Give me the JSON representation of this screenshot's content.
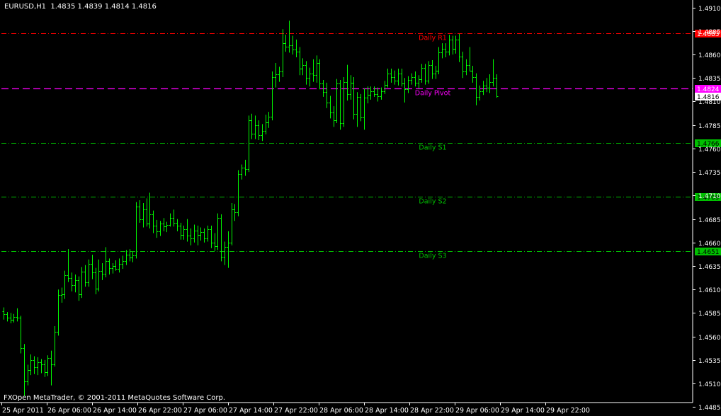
{
  "header": {
    "symbol": "EURUSD,H1",
    "ohlc": "1.4835 1.4839 1.4814 1.4816"
  },
  "footer": {
    "copyright": "FXOpen MetaTrader, © 2001-2011 MetaQuotes Software Corp."
  },
  "colors": {
    "background": "#000000",
    "bars": "#00ff00",
    "axis": "#ffffff",
    "r1": "#ff0000",
    "pivot": "#ff00ff",
    "support": "#00c000"
  },
  "chart_data": {
    "type": "ohlc",
    "grid": false,
    "ylim": [
      1.4495,
      1.4915
    ],
    "yticks": [
      "1.4910",
      "1.4885",
      "1.4860",
      "1.4835",
      "1.4810",
      "1.4785",
      "1.4760",
      "1.4735",
      "1.4710",
      "1.4685",
      "1.4660",
      "1.4635",
      "1.4610",
      "1.4585",
      "1.4560",
      "1.4535",
      "1.4510",
      "1.4485"
    ],
    "xtick_labels": [
      "25 Apr 2011",
      "26 Apr 06:00",
      "26 Apr 14:00",
      "26 Apr 22:00",
      "27 Apr 06:00",
      "27 Apr 14:00",
      "27 Apr 22:00",
      "28 Apr 06:00",
      "28 Apr 14:00",
      "28 Apr 22:00",
      "29 Apr 06:00",
      "29 Apr 14:00",
      "29 Apr 22:00"
    ],
    "levels": [
      {
        "name": "Daily R1",
        "value": 1.4883,
        "tag": "1.4883",
        "color": "#ff0000"
      },
      {
        "name": "Daily Pivot",
        "value": 1.4824,
        "tag": "1.4824",
        "color": "#ff00ff"
      },
      {
        "name": "Daily S1",
        "value": 1.4766,
        "tag": "1.4766",
        "color": "#00c000"
      },
      {
        "name": "Daily S2",
        "value": 1.4709,
        "tag": "1.4709",
        "color": "#00c000"
      },
      {
        "name": "Daily S3",
        "value": 1.4651,
        "tag": "1.4651",
        "color": "#00c000"
      }
    ],
    "current_price": {
      "value": 1.4816,
      "tag": "1.4816"
    },
    "bars": [
      {
        "o": 1.4587,
        "h": 1.4591,
        "l": 1.4578,
        "c": 1.4584
      },
      {
        "o": 1.4584,
        "h": 1.4586,
        "l": 1.4576,
        "c": 1.458
      },
      {
        "o": 1.458,
        "h": 1.4585,
        "l": 1.4574,
        "c": 1.4578
      },
      {
        "o": 1.4578,
        "h": 1.4584,
        "l": 1.4575,
        "c": 1.4581
      },
      {
        "o": 1.4581,
        "h": 1.459,
        "l": 1.4576,
        "c": 1.458
      },
      {
        "o": 1.458,
        "h": 1.4582,
        "l": 1.4542,
        "c": 1.4548
      },
      {
        "o": 1.4548,
        "h": 1.4552,
        "l": 1.4497,
        "c": 1.4512
      },
      {
        "o": 1.4512,
        "h": 1.453,
        "l": 1.4508,
        "c": 1.4524
      },
      {
        "o": 1.4524,
        "h": 1.4541,
        "l": 1.4519,
        "c": 1.4535
      },
      {
        "o": 1.4535,
        "h": 1.4539,
        "l": 1.452,
        "c": 1.4527
      },
      {
        "o": 1.4527,
        "h": 1.4538,
        "l": 1.4519,
        "c": 1.4533
      },
      {
        "o": 1.4533,
        "h": 1.4536,
        "l": 1.4521,
        "c": 1.453
      },
      {
        "o": 1.453,
        "h": 1.4535,
        "l": 1.4517,
        "c": 1.4522
      },
      {
        "o": 1.4522,
        "h": 1.454,
        "l": 1.4518,
        "c": 1.4537
      },
      {
        "o": 1.4537,
        "h": 1.4545,
        "l": 1.4508,
        "c": 1.453
      },
      {
        "o": 1.453,
        "h": 1.4571,
        "l": 1.4528,
        "c": 1.4565
      },
      {
        "o": 1.4565,
        "h": 1.461,
        "l": 1.4561,
        "c": 1.4604
      },
      {
        "o": 1.4604,
        "h": 1.4612,
        "l": 1.4596,
        "c": 1.4605
      },
      {
        "o": 1.4605,
        "h": 1.463,
        "l": 1.46,
        "c": 1.4625
      },
      {
        "o": 1.4625,
        "h": 1.4653,
        "l": 1.4618,
        "c": 1.4622
      },
      {
        "o": 1.4622,
        "h": 1.4628,
        "l": 1.4608,
        "c": 1.4615
      },
      {
        "o": 1.4615,
        "h": 1.4626,
        "l": 1.4607,
        "c": 1.462
      },
      {
        "o": 1.462,
        "h": 1.4624,
        "l": 1.4598,
        "c": 1.4605
      },
      {
        "o": 1.4605,
        "h": 1.4634,
        "l": 1.4601,
        "c": 1.4629
      },
      {
        "o": 1.4629,
        "h": 1.4636,
        "l": 1.4613,
        "c": 1.4618
      },
      {
        "o": 1.4618,
        "h": 1.4642,
        "l": 1.4613,
        "c": 1.4637
      },
      {
        "o": 1.4637,
        "h": 1.4647,
        "l": 1.4621,
        "c": 1.4628
      },
      {
        "o": 1.4628,
        "h": 1.4633,
        "l": 1.4605,
        "c": 1.4611
      },
      {
        "o": 1.4611,
        "h": 1.4642,
        "l": 1.4608,
        "c": 1.463
      },
      {
        "o": 1.463,
        "h": 1.4638,
        "l": 1.462,
        "c": 1.4627
      },
      {
        "o": 1.4627,
        "h": 1.4655,
        "l": 1.4623,
        "c": 1.464
      },
      {
        "o": 1.464,
        "h": 1.4643,
        "l": 1.4626,
        "c": 1.4633
      },
      {
        "o": 1.4633,
        "h": 1.4638,
        "l": 1.4627,
        "c": 1.4635
      },
      {
        "o": 1.4635,
        "h": 1.4641,
        "l": 1.463,
        "c": 1.4632
      },
      {
        "o": 1.4632,
        "h": 1.4643,
        "l": 1.4628,
        "c": 1.4637
      },
      {
        "o": 1.4637,
        "h": 1.4646,
        "l": 1.4632,
        "c": 1.464
      },
      {
        "o": 1.464,
        "h": 1.4652,
        "l": 1.4636,
        "c": 1.4647
      },
      {
        "o": 1.4647,
        "h": 1.4653,
        "l": 1.464,
        "c": 1.4644
      },
      {
        "o": 1.4644,
        "h": 1.465,
        "l": 1.4639,
        "c": 1.4646
      },
      {
        "o": 1.4646,
        "h": 1.4703,
        "l": 1.4643,
        "c": 1.4698
      },
      {
        "o": 1.4698,
        "h": 1.4705,
        "l": 1.4681,
        "c": 1.4685
      },
      {
        "o": 1.4685,
        "h": 1.4702,
        "l": 1.4676,
        "c": 1.4695
      },
      {
        "o": 1.4695,
        "h": 1.4707,
        "l": 1.4677,
        "c": 1.468
      },
      {
        "o": 1.468,
        "h": 1.4713,
        "l": 1.4675,
        "c": 1.469
      },
      {
        "o": 1.469,
        "h": 1.4694,
        "l": 1.467,
        "c": 1.4678
      },
      {
        "o": 1.4678,
        "h": 1.4684,
        "l": 1.4665,
        "c": 1.4672
      },
      {
        "o": 1.4672,
        "h": 1.4683,
        "l": 1.4667,
        "c": 1.468
      },
      {
        "o": 1.468,
        "h": 1.4686,
        "l": 1.4672,
        "c": 1.4677
      },
      {
        "o": 1.4677,
        "h": 1.4682,
        "l": 1.4671,
        "c": 1.4679
      },
      {
        "o": 1.4679,
        "h": 1.4691,
        "l": 1.4677,
        "c": 1.4686
      },
      {
        "o": 1.4686,
        "h": 1.4695,
        "l": 1.4677,
        "c": 1.4681
      },
      {
        "o": 1.4681,
        "h": 1.4685,
        "l": 1.4672,
        "c": 1.4678
      },
      {
        "o": 1.4678,
        "h": 1.4681,
        "l": 1.4663,
        "c": 1.4668
      },
      {
        "o": 1.4668,
        "h": 1.4678,
        "l": 1.4663,
        "c": 1.4674
      },
      {
        "o": 1.4674,
        "h": 1.4685,
        "l": 1.4661,
        "c": 1.4667
      },
      {
        "o": 1.4667,
        "h": 1.4675,
        "l": 1.4657,
        "c": 1.4664
      },
      {
        "o": 1.4664,
        "h": 1.4679,
        "l": 1.466,
        "c": 1.4673
      },
      {
        "o": 1.4673,
        "h": 1.4678,
        "l": 1.4657,
        "c": 1.4668
      },
      {
        "o": 1.4668,
        "h": 1.4676,
        "l": 1.4662,
        "c": 1.4671
      },
      {
        "o": 1.4671,
        "h": 1.4675,
        "l": 1.466,
        "c": 1.4664
      },
      {
        "o": 1.4664,
        "h": 1.4678,
        "l": 1.4661,
        "c": 1.4674
      },
      {
        "o": 1.4674,
        "h": 1.4678,
        "l": 1.4654,
        "c": 1.466
      },
      {
        "o": 1.466,
        "h": 1.467,
        "l": 1.4651,
        "c": 1.4656
      },
      {
        "o": 1.4656,
        "h": 1.4691,
        "l": 1.4652,
        "c": 1.4686
      },
      {
        "o": 1.4686,
        "h": 1.469,
        "l": 1.464,
        "c": 1.4645
      },
      {
        "o": 1.4645,
        "h": 1.4661,
        "l": 1.4636,
        "c": 1.4655
      },
      {
        "o": 1.4655,
        "h": 1.4672,
        "l": 1.4633,
        "c": 1.466
      },
      {
        "o": 1.466,
        "h": 1.4702,
        "l": 1.4657,
        "c": 1.4695
      },
      {
        "o": 1.4695,
        "h": 1.4701,
        "l": 1.4683,
        "c": 1.4692
      },
      {
        "o": 1.4692,
        "h": 1.4737,
        "l": 1.4688,
        "c": 1.4733
      },
      {
        "o": 1.4733,
        "h": 1.4743,
        "l": 1.4727,
        "c": 1.474
      },
      {
        "o": 1.474,
        "h": 1.4748,
        "l": 1.4731,
        "c": 1.4738
      },
      {
        "o": 1.4738,
        "h": 1.4795,
        "l": 1.4735,
        "c": 1.479
      },
      {
        "o": 1.479,
        "h": 1.4797,
        "l": 1.477,
        "c": 1.4776
      },
      {
        "o": 1.4776,
        "h": 1.4795,
        "l": 1.477,
        "c": 1.4785
      },
      {
        "o": 1.4785,
        "h": 1.479,
        "l": 1.4769,
        "c": 1.4774
      },
      {
        "o": 1.4774,
        "h": 1.4786,
        "l": 1.4768,
        "c": 1.4779
      },
      {
        "o": 1.4779,
        "h": 1.4796,
        "l": 1.4775,
        "c": 1.4788
      },
      {
        "o": 1.4788,
        "h": 1.4799,
        "l": 1.4782,
        "c": 1.4794
      },
      {
        "o": 1.4794,
        "h": 1.4842,
        "l": 1.479,
        "c": 1.4836
      },
      {
        "o": 1.4836,
        "h": 1.4851,
        "l": 1.4825,
        "c": 1.4839
      },
      {
        "o": 1.4839,
        "h": 1.4847,
        "l": 1.4831,
        "c": 1.4842
      },
      {
        "o": 1.4842,
        "h": 1.4887,
        "l": 1.4836,
        "c": 1.4872
      },
      {
        "o": 1.4872,
        "h": 1.4881,
        "l": 1.4863,
        "c": 1.4868
      },
      {
        "o": 1.4868,
        "h": 1.4896,
        "l": 1.4862,
        "c": 1.487
      },
      {
        "o": 1.487,
        "h": 1.488,
        "l": 1.486,
        "c": 1.4865
      },
      {
        "o": 1.4865,
        "h": 1.4876,
        "l": 1.4857,
        "c": 1.4863
      },
      {
        "o": 1.4863,
        "h": 1.4868,
        "l": 1.4838,
        "c": 1.4845
      },
      {
        "o": 1.4845,
        "h": 1.4856,
        "l": 1.4838,
        "c": 1.4849
      },
      {
        "o": 1.4849,
        "h": 1.4853,
        "l": 1.4828,
        "c": 1.4835
      },
      {
        "o": 1.4835,
        "h": 1.4846,
        "l": 1.4826,
        "c": 1.484
      },
      {
        "o": 1.484,
        "h": 1.4855,
        "l": 1.4831,
        "c": 1.4838
      },
      {
        "o": 1.4838,
        "h": 1.4859,
        "l": 1.483,
        "c": 1.4851
      },
      {
        "o": 1.4851,
        "h": 1.4855,
        "l": 1.4823,
        "c": 1.4829
      },
      {
        "o": 1.4829,
        "h": 1.4833,
        "l": 1.4815,
        "c": 1.482
      },
      {
        "o": 1.482,
        "h": 1.483,
        "l": 1.4803,
        "c": 1.4809
      },
      {
        "o": 1.4809,
        "h": 1.4816,
        "l": 1.4792,
        "c": 1.4798
      },
      {
        "o": 1.4798,
        "h": 1.4805,
        "l": 1.4783,
        "c": 1.479
      },
      {
        "o": 1.479,
        "h": 1.4834,
        "l": 1.4787,
        "c": 1.4829
      },
      {
        "o": 1.4829,
        "h": 1.4833,
        "l": 1.478,
        "c": 1.4787
      },
      {
        "o": 1.4787,
        "h": 1.4836,
        "l": 1.4783,
        "c": 1.4831
      },
      {
        "o": 1.4831,
        "h": 1.4849,
        "l": 1.4811,
        "c": 1.4818
      },
      {
        "o": 1.4818,
        "h": 1.4838,
        "l": 1.4812,
        "c": 1.483
      },
      {
        "o": 1.483,
        "h": 1.4836,
        "l": 1.4791,
        "c": 1.4797
      },
      {
        "o": 1.4797,
        "h": 1.482,
        "l": 1.4783,
        "c": 1.4815
      },
      {
        "o": 1.4815,
        "h": 1.4818,
        "l": 1.4789,
        "c": 1.4793
      },
      {
        "o": 1.4793,
        "h": 1.4824,
        "l": 1.478,
        "c": 1.4814
      },
      {
        "o": 1.4814,
        "h": 1.4826,
        "l": 1.4808,
        "c": 1.4817
      },
      {
        "o": 1.4817,
        "h": 1.4826,
        "l": 1.4812,
        "c": 1.4821
      },
      {
        "o": 1.4821,
        "h": 1.4826,
        "l": 1.4815,
        "c": 1.4818
      },
      {
        "o": 1.4818,
        "h": 1.4825,
        "l": 1.481,
        "c": 1.4816
      },
      {
        "o": 1.4816,
        "h": 1.4825,
        "l": 1.4812,
        "c": 1.4821
      },
      {
        "o": 1.4821,
        "h": 1.4832,
        "l": 1.4818,
        "c": 1.4828
      },
      {
        "o": 1.4828,
        "h": 1.4845,
        "l": 1.4825,
        "c": 1.484
      },
      {
        "o": 1.484,
        "h": 1.4845,
        "l": 1.483,
        "c": 1.4836
      },
      {
        "o": 1.4836,
        "h": 1.4843,
        "l": 1.4828,
        "c": 1.4832
      },
      {
        "o": 1.4832,
        "h": 1.4845,
        "l": 1.4827,
        "c": 1.484
      },
      {
        "o": 1.484,
        "h": 1.4845,
        "l": 1.4826,
        "c": 1.4829
      },
      {
        "o": 1.4829,
        "h": 1.4835,
        "l": 1.4809,
        "c": 1.4823
      },
      {
        "o": 1.4823,
        "h": 1.4837,
        "l": 1.4819,
        "c": 1.4833
      },
      {
        "o": 1.4833,
        "h": 1.484,
        "l": 1.4828,
        "c": 1.4836
      },
      {
        "o": 1.4836,
        "h": 1.4842,
        "l": 1.4826,
        "c": 1.483
      },
      {
        "o": 1.483,
        "h": 1.4838,
        "l": 1.4824,
        "c": 1.4834
      },
      {
        "o": 1.4834,
        "h": 1.485,
        "l": 1.483,
        "c": 1.4846
      },
      {
        "o": 1.4846,
        "h": 1.485,
        "l": 1.4828,
        "c": 1.4832
      },
      {
        "o": 1.4832,
        "h": 1.4853,
        "l": 1.4829,
        "c": 1.4849
      },
      {
        "o": 1.4849,
        "h": 1.4854,
        "l": 1.4834,
        "c": 1.484
      },
      {
        "o": 1.484,
        "h": 1.4848,
        "l": 1.4834,
        "c": 1.4843
      },
      {
        "o": 1.4843,
        "h": 1.4868,
        "l": 1.4839,
        "c": 1.4862
      },
      {
        "o": 1.4862,
        "h": 1.4872,
        "l": 1.4856,
        "c": 1.4866
      },
      {
        "o": 1.4866,
        "h": 1.4872,
        "l": 1.4857,
        "c": 1.4863
      },
      {
        "o": 1.4863,
        "h": 1.4881,
        "l": 1.4859,
        "c": 1.4876
      },
      {
        "o": 1.4876,
        "h": 1.488,
        "l": 1.486,
        "c": 1.4866
      },
      {
        "o": 1.4866,
        "h": 1.488,
        "l": 1.4861,
        "c": 1.4876
      },
      {
        "o": 1.4876,
        "h": 1.4882,
        "l": 1.4852,
        "c": 1.4858
      },
      {
        "o": 1.4858,
        "h": 1.4863,
        "l": 1.4835,
        "c": 1.4842
      },
      {
        "o": 1.4842,
        "h": 1.4855,
        "l": 1.4838,
        "c": 1.4849
      },
      {
        "o": 1.4849,
        "h": 1.4868,
        "l": 1.4842,
        "c": 1.4843
      },
      {
        "o": 1.4843,
        "h": 1.4848,
        "l": 1.483,
        "c": 1.4836
      },
      {
        "o": 1.4836,
        "h": 1.484,
        "l": 1.4806,
        "c": 1.4815
      },
      {
        "o": 1.4815,
        "h": 1.4827,
        "l": 1.4811,
        "c": 1.4821
      },
      {
        "o": 1.4821,
        "h": 1.4832,
        "l": 1.4817,
        "c": 1.4827
      },
      {
        "o": 1.4827,
        "h": 1.4835,
        "l": 1.482,
        "c": 1.4825
      },
      {
        "o": 1.4825,
        "h": 1.4839,
        "l": 1.4819,
        "c": 1.4831
      },
      {
        "o": 1.4831,
        "h": 1.4855,
        "l": 1.4826,
        "c": 1.4835
      },
      {
        "o": 1.4835,
        "h": 1.4839,
        "l": 1.4814,
        "c": 1.4816
      }
    ]
  }
}
